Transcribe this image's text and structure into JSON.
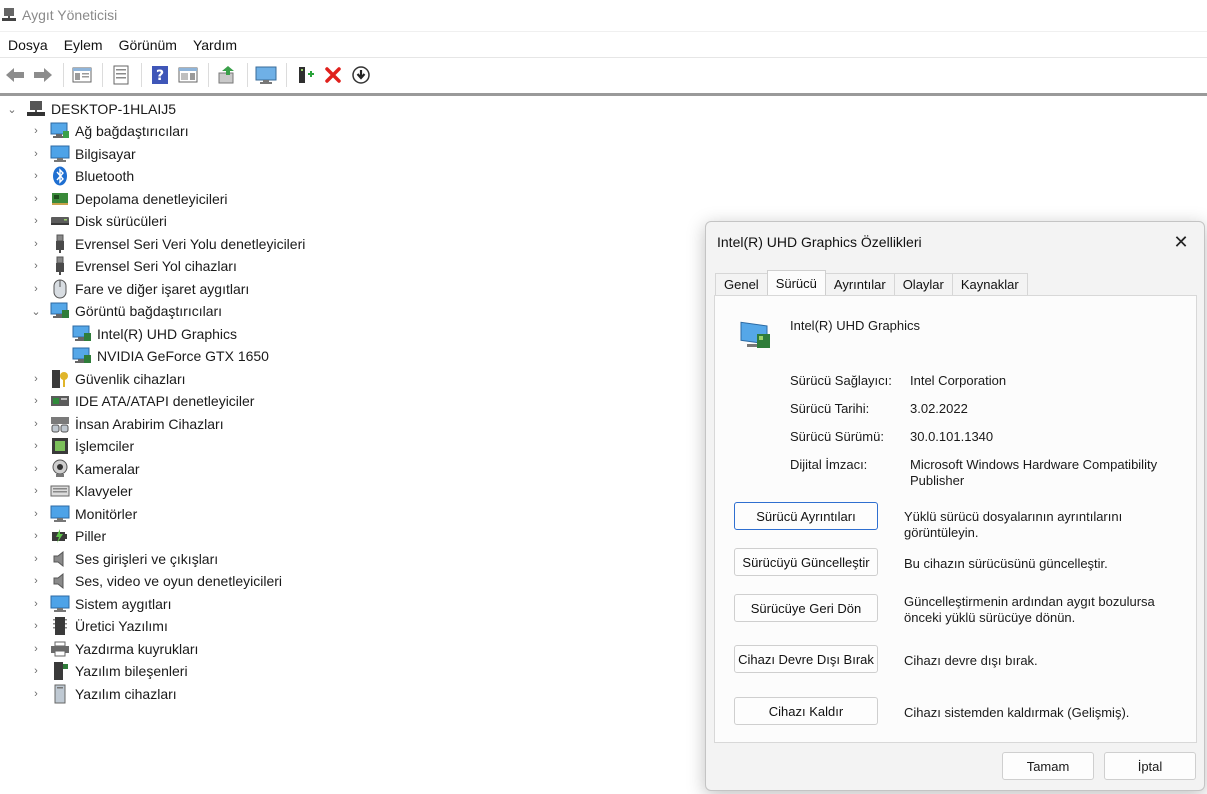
{
  "window": {
    "title": "Aygıt Yöneticisi"
  },
  "menu": [
    "Dosya",
    "Eylem",
    "Görünüm",
    "Yardım"
  ],
  "toolbar": {
    "buttons": [
      "back-icon",
      "forward-icon",
      "properties-view-icon",
      "document-icon",
      "help-icon",
      "console-tree-icon",
      "update-driver-icon",
      "monitor-scan-icon",
      "add-device-icon",
      "uninstall-icon",
      "disable-device-icon"
    ]
  },
  "tree": {
    "root": "DESKTOP-1HLAIJ5",
    "categories": [
      "Ağ bağdaştırıcıları",
      "Bilgisayar",
      "Bluetooth",
      "Depolama denetleyicileri",
      "Disk sürücüleri",
      "Evrensel Seri Veri Yolu denetleyicileri",
      "Evrensel Seri Yol cihazları",
      "Fare ve diğer işaret aygıtları",
      "Görüntü bağdaştırıcıları",
      "Intel(R) UHD Graphics",
      "NVIDIA GeForce GTX 1650",
      "Güvenlik cihazları",
      "IDE ATA/ATAPI denetleyiciler",
      "İnsan Arabirim Cihazları",
      "İşlemciler",
      "Kameralar",
      "Klavyeler",
      "Monitörler",
      "Piller",
      "Ses girişleri ve çıkışları",
      "Ses, video ve oyun denetleyicileri",
      "Sistem aygıtları",
      "Üretici Yazılımı",
      "Yazdırma kuyrukları",
      "Yazılım bileşenleri",
      "Yazılım cihazları"
    ]
  },
  "dialog": {
    "title": "Intel(R) UHD Graphics Özellikleri",
    "close": "✕",
    "tabs": [
      "Genel",
      "Sürücü",
      "Ayrıntılar",
      "Olaylar",
      "Kaynaklar"
    ],
    "active_tab": "Sürücü",
    "device_name": "Intel(R) UHD Graphics",
    "props": [
      {
        "k": "Sürücü Sağlayıcı:",
        "v": "Intel Corporation"
      },
      {
        "k": "Sürücü Tarihi:",
        "v": "3.02.2022"
      },
      {
        "k": "Sürücü Sürümü:",
        "v": "30.0.101.1340"
      },
      {
        "k": "Dijital İmzacı:",
        "v": "Microsoft Windows Hardware Compatibility Publisher"
      }
    ],
    "actions": [
      {
        "label": "Sürücü Ayrıntıları",
        "desc": "Yüklü sürücü dosyalarının ayrıntılarını görüntüleyin."
      },
      {
        "label": "Sürücüyü Güncelleştir",
        "desc": "Bu cihazın sürücüsünü güncelleştir."
      },
      {
        "label": "Sürücüye Geri Dön",
        "desc": "Güncelleştirmenin ardından aygıt bozulursa önceki yüklü sürücüye dönün."
      },
      {
        "label": "Cihazı Devre Dışı Bırak",
        "desc": "Cihazı devre dışı bırak."
      },
      {
        "label": "Cihazı Kaldır",
        "desc": "Cihazı sistemden kaldırmak (Gelişmiş)."
      }
    ],
    "ok": "Tamam",
    "cancel": "İptal"
  }
}
